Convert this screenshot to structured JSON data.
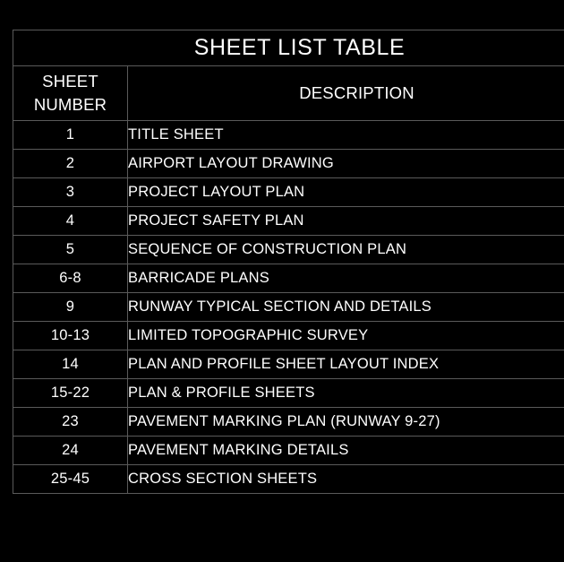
{
  "document": {
    "title": "SHEET LIST TABLE",
    "background_color": "#000000",
    "text_color": "#ffffff",
    "border_color": "#5a5a5a"
  },
  "table": {
    "title": "SHEET LIST TABLE",
    "headers": {
      "number_line1": "SHEET",
      "number_line2": "NUMBER",
      "description": "DESCRIPTION"
    },
    "rows": [
      {
        "number": "1",
        "description": "TITLE SHEET"
      },
      {
        "number": "2",
        "description": "AIRPORT LAYOUT DRAWING"
      },
      {
        "number": "3",
        "description": "PROJECT LAYOUT PLAN"
      },
      {
        "number": "4",
        "description": "PROJECT SAFETY PLAN"
      },
      {
        "number": "5",
        "description": "SEQUENCE OF CONSTRUCTION PLAN"
      },
      {
        "number": "6-8",
        "description": "BARRICADE PLANS"
      },
      {
        "number": "9",
        "description": "RUNWAY TYPICAL SECTION AND DETAILS"
      },
      {
        "number": "10-13",
        "description": "LIMITED TOPOGRAPHIC SURVEY"
      },
      {
        "number": "14",
        "description": "PLAN AND PROFILE SHEET LAYOUT INDEX"
      },
      {
        "number": "15-22",
        "description": "PLAN & PROFILE SHEETS"
      },
      {
        "number": "23",
        "description": "PAVEMENT MARKING PLAN (RUNWAY 9-27)"
      },
      {
        "number": "24",
        "description": "PAVEMENT MARKING DETAILS"
      },
      {
        "number": "25-45",
        "description": "CROSS SECTION SHEETS"
      }
    ]
  }
}
